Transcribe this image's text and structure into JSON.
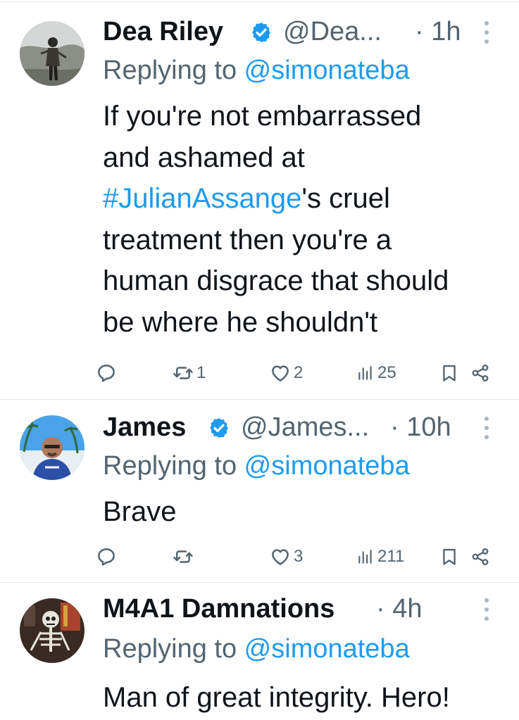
{
  "tweets": [
    {
      "name": "Dea Riley",
      "verified": true,
      "handle": "@Dea...",
      "time": "· 1h",
      "replying_prefix": "Replying to ",
      "replying_to": "@simonateba",
      "body_lines": [
        "If you're not embarrassed",
        "and ashamed at"
      ],
      "hashtag": "#JulianAssange",
      "body_after_hashtag": "'s cruel",
      "body_lines_rest": [
        "treatment then you're a",
        "human disgrace that should",
        "be where he shouldn't"
      ],
      "reposts": "1",
      "likes": "2",
      "views": "25"
    },
    {
      "name": "James",
      "verified": true,
      "handle": "@James...",
      "time": "· 10h",
      "replying_prefix": "Replying to ",
      "replying_to": "@simonateba",
      "body": "Brave",
      "reposts": "",
      "likes": "3",
      "views": "211"
    },
    {
      "name": "M4A1 Damnations",
      "verified": false,
      "time": "· 4h",
      "replying_prefix": "Replying to ",
      "replying_to": "@simonateba",
      "body": "Man of great integrity. Hero!"
    }
  ],
  "icons": {
    "reply": "reply-icon",
    "repost": "repost-icon",
    "like": "heart-icon",
    "views": "views-icon",
    "bookmark": "bookmark-icon",
    "share": "share-icon",
    "verified": "verified-badge-icon",
    "more": "more-icon"
  },
  "colors": {
    "text": "#0f1419",
    "secondary": "#536471",
    "link": "#1d9bf0",
    "verified": "#1d9bf0",
    "divider": "#e1e6ea"
  }
}
